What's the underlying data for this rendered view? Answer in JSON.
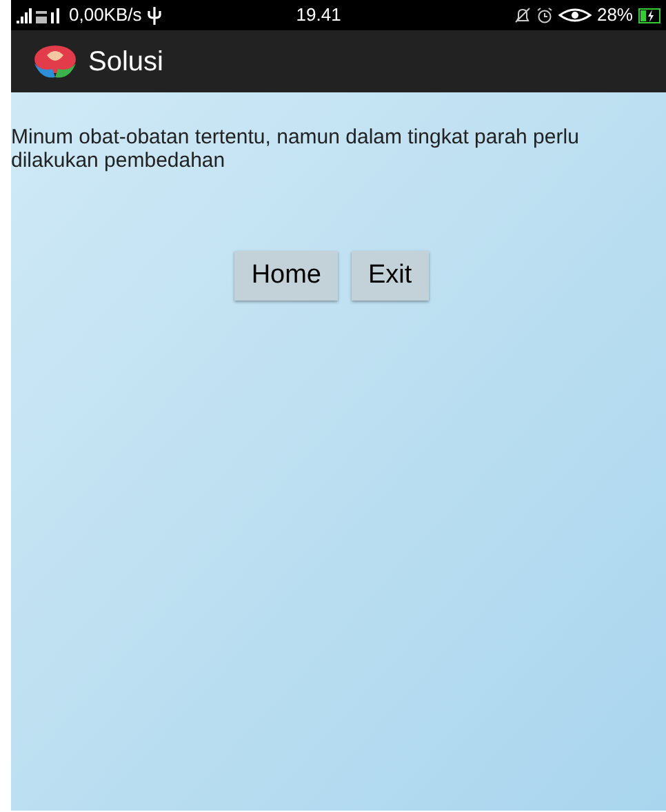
{
  "status_bar": {
    "speed": "0,00KB/s",
    "time": "19.41",
    "battery": "28%"
  },
  "app_bar": {
    "title": "Solusi"
  },
  "content": {
    "text": "Minum obat-obatan tertentu, namun dalam tingkat parah perlu dilakukan pembedahan"
  },
  "buttons": [
    "Home",
    "Exit"
  ]
}
